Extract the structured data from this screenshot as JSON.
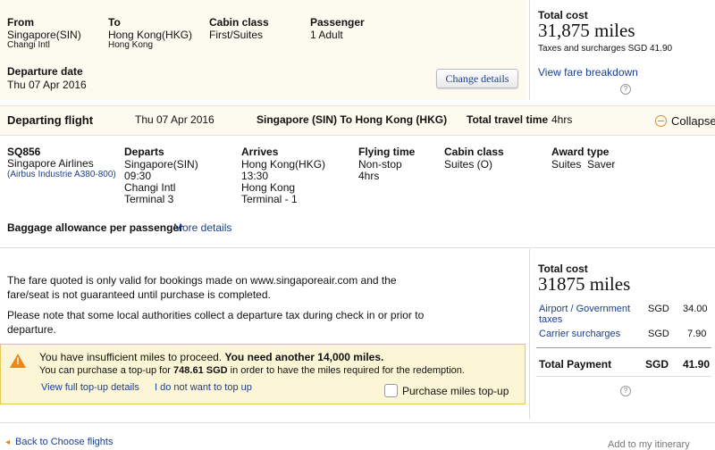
{
  "summary": {
    "from_label": "From",
    "from_city": "Singapore(SIN)",
    "from_airport": "Changi Intl",
    "to_label": "To",
    "to_city": "Hong Kong(HKG)",
    "to_airport": "Hong Kong",
    "cabin_label": "Cabin class",
    "cabin_value": "First/Suites",
    "passenger_label": "Passenger",
    "passenger_value": "1 Adult",
    "departure_label": "Departure date",
    "departure_value": "Thu 07 Apr 2016",
    "change_button": "Change details"
  },
  "cost_top": {
    "label": "Total cost",
    "miles": "31,875 miles",
    "taxes": "Taxes and surcharges SGD 41.90",
    "fare_link": "View fare breakdown",
    "help": "?"
  },
  "flight_bar": {
    "title": "Departing flight",
    "date": "Thu 07 Apr 2016",
    "route": "Singapore (SIN) To Hong Kong (HKG)",
    "travel_label": "Total travel time",
    "travel_value": "4hrs",
    "collapse": "Collapse"
  },
  "flight": {
    "number": "SQ856",
    "airline": "Singapore Airlines",
    "aircraft": "(Airbus Industrie A380-800)",
    "departs_label": "Departs",
    "departs_city": "Singapore(SIN)",
    "departs_time": "09:30",
    "departs_airport": "Changi Intl",
    "departs_terminal": "Terminal 3",
    "arrives_label": "Arrives",
    "arrives_city": "Hong Kong(HKG)",
    "arrives_time": "13:30",
    "arrives_airport": "Hong Kong",
    "arrives_terminal": "Terminal - 1",
    "flying_label": "Flying time",
    "flying_stops": "Non-stop",
    "flying_value": "4hrs",
    "cabin_label": "Cabin class",
    "cabin_value": "Suites (O)",
    "award_label": "Award type",
    "award_value": "Suites  Saver",
    "baggage_label": "Baggage allowance per passenger",
    "more_details": "More details"
  },
  "notes": {
    "fare_note": "The fare quoted is only valid for bookings made on www.singaporeair.com and the fare/seat is not guaranteed until purchase is completed.",
    "tax_note": "Please note that some local authorities collect a departure tax during check in or prior to departure."
  },
  "warning": {
    "line1_start": "You have insufficient miles to proceed.",
    "line1_bold": "You need another 14,000 miles.",
    "line2_start": "You can purchase a top-up for",
    "line2_bold": "748.61 SGD",
    "line2_end": "in order to have the miles required for the redemption.",
    "view_link": "View full top-up details",
    "decline_link": "I do not want to top up",
    "purchase_label": "Purchase miles top-up"
  },
  "cost_bottom": {
    "label": "Total cost",
    "miles": "31875 miles",
    "rows": [
      {
        "label": "Airport / Government taxes",
        "currency": "SGD",
        "amount": "34.00"
      },
      {
        "label": "Carrier surcharges",
        "currency": "SGD",
        "amount": "7.90"
      }
    ],
    "total_label": "Total Payment",
    "total_currency": "SGD",
    "total_amount": "41.90",
    "help": "?"
  },
  "footer": {
    "back_link": "Back to Choose flights",
    "right_text": "Add to my itinerary"
  },
  "colors": {
    "panel_bg": "#fdfbf0",
    "link": "#1a3f8f",
    "warning_bg": "#fdf6d6",
    "warning_border": "#e8c75a",
    "warning_icon": "#e8891e"
  }
}
